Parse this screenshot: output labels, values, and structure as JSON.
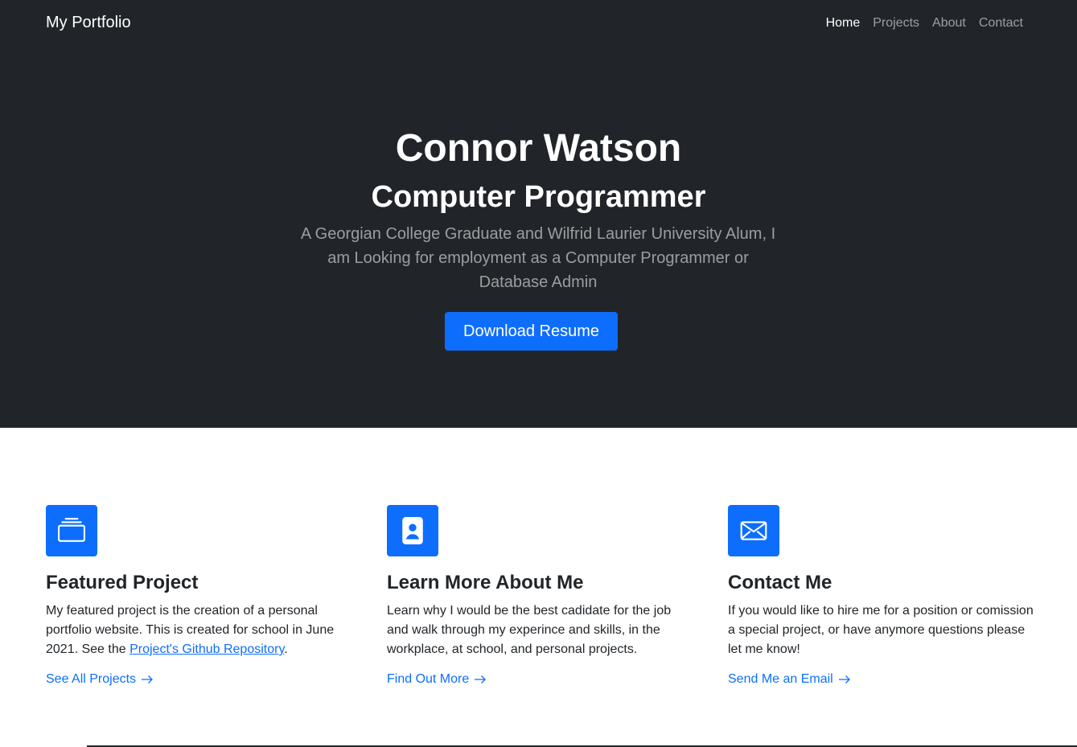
{
  "navbar": {
    "brand": "My Portfolio",
    "links": [
      {
        "label": "Home",
        "active": true
      },
      {
        "label": "Projects",
        "active": false
      },
      {
        "label": "About",
        "active": false
      },
      {
        "label": "Contact",
        "active": false
      }
    ]
  },
  "hero": {
    "name": "Connor Watson",
    "role": "Computer Programmer",
    "lead": "A Georgian College Graduate and Wilfrid Laurier University Alum, I am Looking for employment as a Computer Programmer or Database Admin",
    "button_label": "Download Resume"
  },
  "features": [
    {
      "icon": "collection-icon",
      "title": "Featured Project",
      "text_before_link": "My featured project is the creation of a personal portfolio website. This is created for school in June 2021. See the ",
      "link_text": "Project's Github Repository",
      "text_after_link": ".",
      "more_label": "See All Projects"
    },
    {
      "icon": "person-badge-icon",
      "title": "Learn More About Me",
      "text": "Learn why I would be the best cadidate for the job and walk through my experince and skills, in the workplace, at school, and personal projects.",
      "more_label": "Find Out More"
    },
    {
      "icon": "envelope-icon",
      "title": "Contact Me",
      "text": "If you would like to hire me for a position or comission a special project, or have anymore questions please let me know!",
      "more_label": "Send Me an Email"
    }
  ],
  "colors": {
    "dark": "#212529",
    "primary": "#0d6efd",
    "white": "#ffffff"
  }
}
